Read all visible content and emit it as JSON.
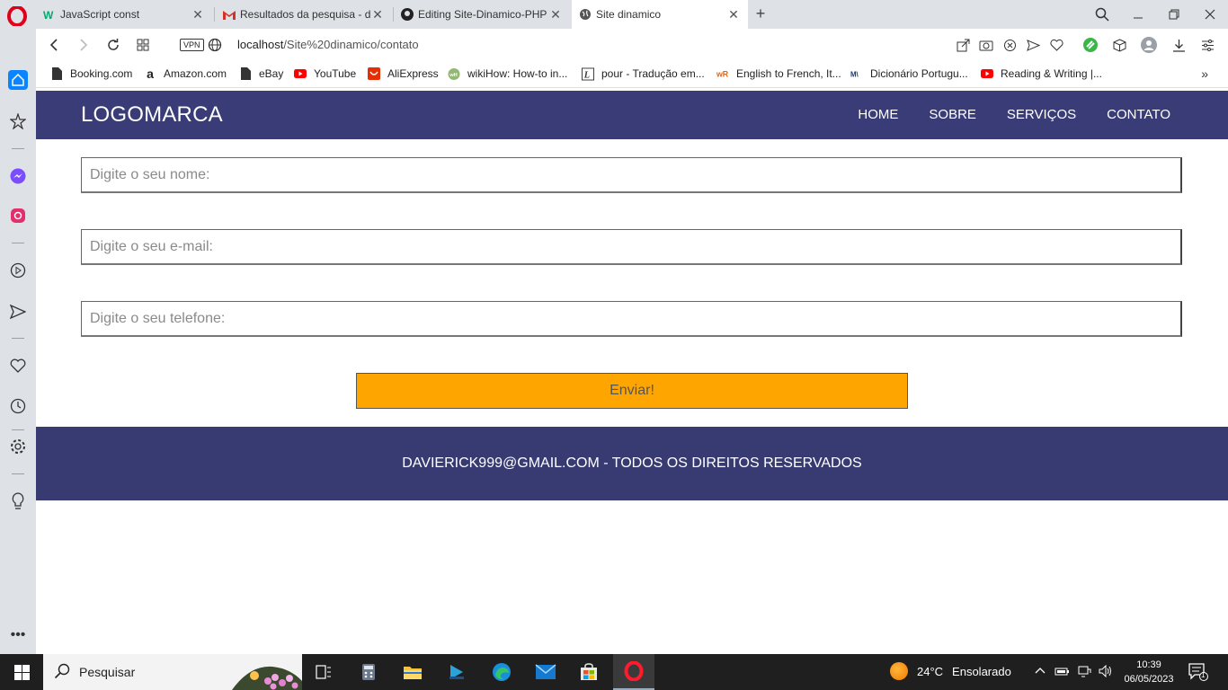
{
  "browser": {
    "tabs": [
      {
        "title": "JavaScript const"
      },
      {
        "title": "Resultados da pesquisa - d"
      },
      {
        "title": "Editing Site-Dinamico-PHP"
      },
      {
        "title": "Site dinamico"
      }
    ],
    "address": {
      "vpn": "VPN",
      "host": "localhost",
      "path": "/Site%20dinamico/contato"
    },
    "bookmarks": [
      {
        "label": "Booking.com"
      },
      {
        "label": "Amazon.com"
      },
      {
        "label": "eBay"
      },
      {
        "label": "YouTube"
      },
      {
        "label": "AliExpress"
      },
      {
        "label": "wikiHow: How-to in..."
      },
      {
        "label": "pour - Tradução em..."
      },
      {
        "label": "English to French, It..."
      },
      {
        "label": "Dicionário Portugu..."
      },
      {
        "label": "Reading & Writing |..."
      }
    ]
  },
  "site": {
    "logo": "LOGOMARCA",
    "menu": [
      "HOME",
      "SOBRE",
      "SERVIÇOS",
      "CONTATO"
    ],
    "form": {
      "name_placeholder": "Digite o seu nome:",
      "email_placeholder": "Digite o seu e-mail:",
      "phone_placeholder": "Digite o seu telefone:",
      "submit_label": "Enviar!"
    },
    "footer": "DAVIERICK999@GMAIL.COM - TODOS OS DIREITOS RESERVADOS",
    "colors": {
      "header": "#3a3c78",
      "footer": "#383a72",
      "button": "#ffa500"
    }
  },
  "taskbar": {
    "search_label": "Pesquisar",
    "weather_temp": "24°C",
    "weather_condition": "Ensolarado",
    "time": "10:39",
    "date": "06/05/2023",
    "notifications": "1"
  }
}
